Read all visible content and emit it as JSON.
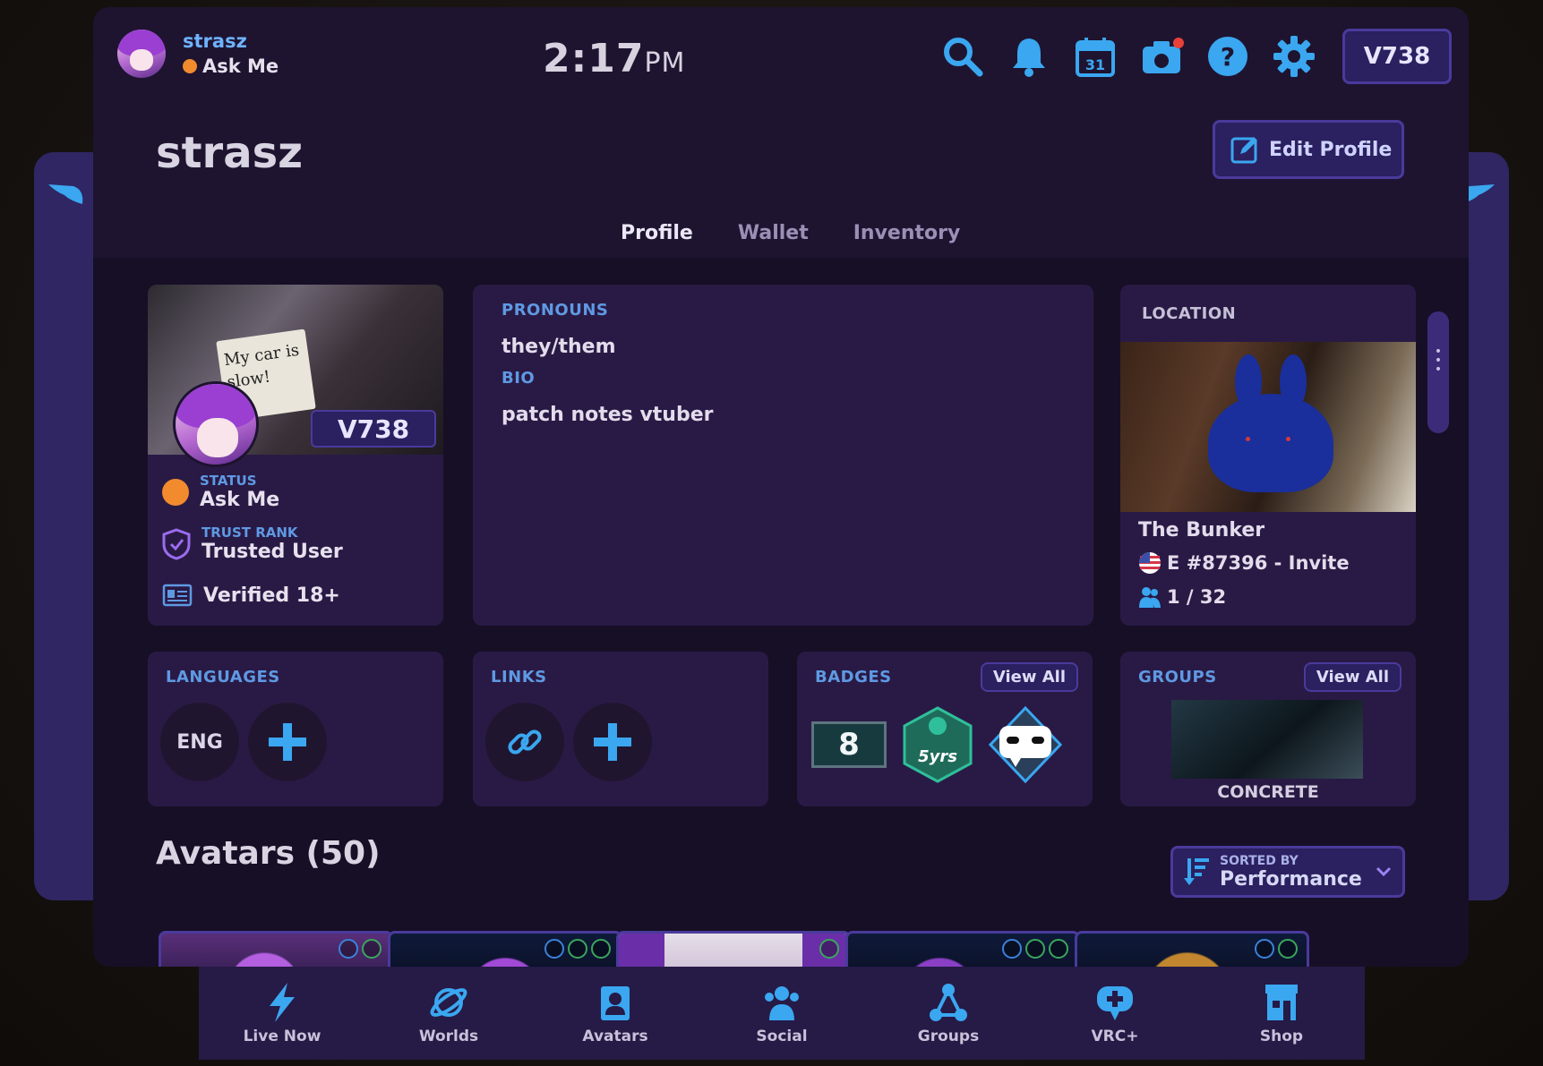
{
  "user": {
    "name": "strasz",
    "status": "Ask Me"
  },
  "clock": {
    "time": "2:17",
    "ampm": "PM"
  },
  "currency": "738",
  "header": {
    "title": "strasz",
    "edit_label": "Edit Profile"
  },
  "tabs": [
    {
      "label": "Profile"
    },
    {
      "label": "Wallet"
    },
    {
      "label": "Inventory"
    }
  ],
  "profile": {
    "banner_sign": "My car is slow!",
    "status_label": "STATUS",
    "status_value": "Ask Me",
    "trust_label": "TRUST RANK",
    "trust_value": "Trusted User",
    "verified": "Verified 18+"
  },
  "bio": {
    "pronouns_label": "PRONOUNS",
    "pronouns": "they/them",
    "bio_label": "BIO",
    "bio": "patch notes vtuber"
  },
  "location": {
    "label": "LOCATION",
    "world": "The Bunker",
    "instance": "E #87396 - Invite",
    "players": "1 / 32"
  },
  "languages": {
    "label": "LANGUAGES",
    "items": [
      "ENG"
    ]
  },
  "links": {
    "label": "LINKS"
  },
  "badges": {
    "label": "BADGES",
    "view_all": "View All",
    "count_badge": "8",
    "years_badge": "5yrs"
  },
  "groups": {
    "label": "GROUPS",
    "view_all": "View All",
    "group_name": "CONCRETE"
  },
  "avatars": {
    "title": "Avatars (50)",
    "sorted_by_label": "SORTED BY",
    "sorted_by": "Performance"
  },
  "nav": [
    {
      "label": "Live Now",
      "icon": "lightning-icon"
    },
    {
      "label": "Worlds",
      "icon": "planet-icon"
    },
    {
      "label": "Avatars",
      "icon": "avatar-card-icon"
    },
    {
      "label": "Social",
      "icon": "people-icon"
    },
    {
      "label": "Groups",
      "icon": "network-icon"
    },
    {
      "label": "VRC+",
      "icon": "vrc-plus-icon"
    },
    {
      "label": "Shop",
      "icon": "shop-icon"
    }
  ],
  "colors": {
    "accent": "#7a55e6",
    "label_blue": "#5f99e3",
    "icon_blue": "#3aa7f0",
    "status_orange": "#f28a2e",
    "panel": "#1e1430"
  }
}
